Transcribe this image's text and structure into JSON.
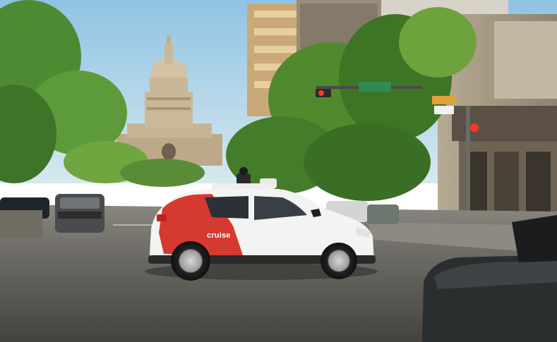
{
  "photo": {
    "vehicle_brand_text": "cruise",
    "colors": {
      "sky": "#a9d2ea",
      "foliage": "#3f7d2d",
      "capitol": "#c9b394",
      "road": "#5e5c57",
      "car_body": "#f2f2f2",
      "car_accent": "#d9382f"
    }
  }
}
